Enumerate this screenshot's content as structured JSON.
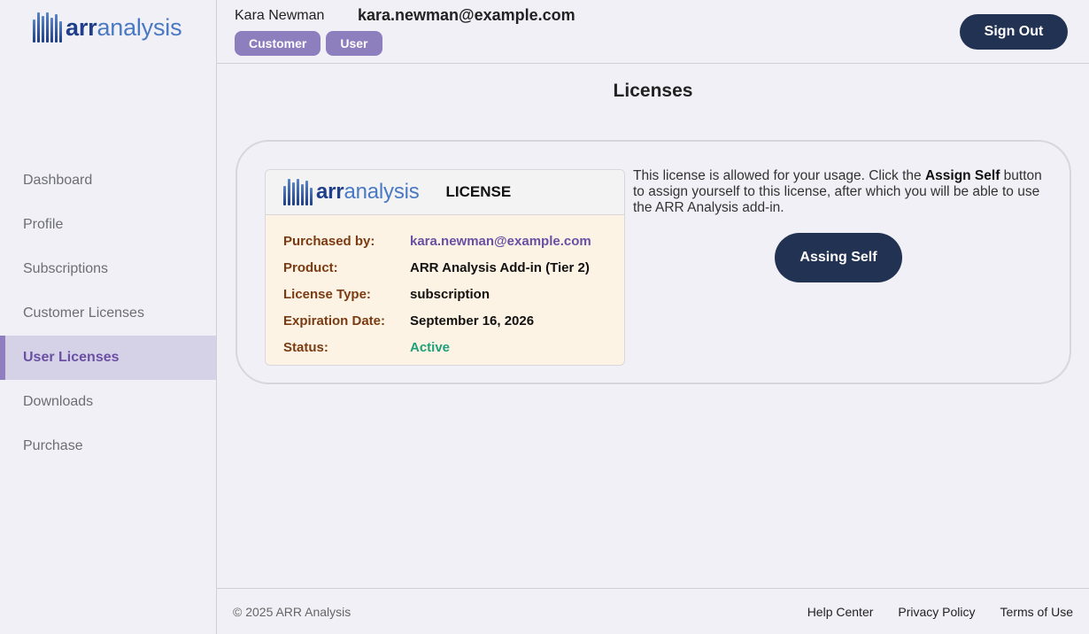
{
  "brand": {
    "part1": "arr",
    "part2": "analysis"
  },
  "sidebar": {
    "items": [
      {
        "label": "Dashboard"
      },
      {
        "label": "Profile"
      },
      {
        "label": "Subscriptions"
      },
      {
        "label": "Customer Licenses"
      },
      {
        "label": "User Licenses",
        "active": true
      },
      {
        "label": "Downloads"
      },
      {
        "label": "Purchase"
      }
    ]
  },
  "header": {
    "user_name": "Kara Newman",
    "user_email": "kara.newman@example.com",
    "roles": [
      "Customer",
      "User"
    ],
    "sign_out_label": "Sign Out"
  },
  "main": {
    "title": "Licenses",
    "license": {
      "card_title": "LICENSE",
      "fields": [
        {
          "label": "Purchased by:",
          "value": "kara.newman@example.com"
        },
        {
          "label": "Product:",
          "value": "ARR Analysis Add-in (Tier 2)"
        },
        {
          "label": "License Type:",
          "value": "subscription"
        },
        {
          "label": "Expiration Date:",
          "value": "September 16, 2026"
        },
        {
          "label": "Status:",
          "value": "Active"
        }
      ],
      "description_pre": "This license is allowed for your usage. Click the ",
      "description_bold": "Assign Self",
      "description_post": " button to assign yourself to this license, after which you will be able to use the ARR Analysis add-in.",
      "assign_label": "Assing Self"
    }
  },
  "footer": {
    "copyright": "© 2025 ARR Analysis",
    "links": [
      "Help Center",
      "Privacy Policy",
      "Terms of Use"
    ]
  },
  "colors": {
    "accent": "#8d7fbe",
    "dark_button": "#223252",
    "status_active": "#1ea07a",
    "label_brown": "#7a3b12"
  }
}
